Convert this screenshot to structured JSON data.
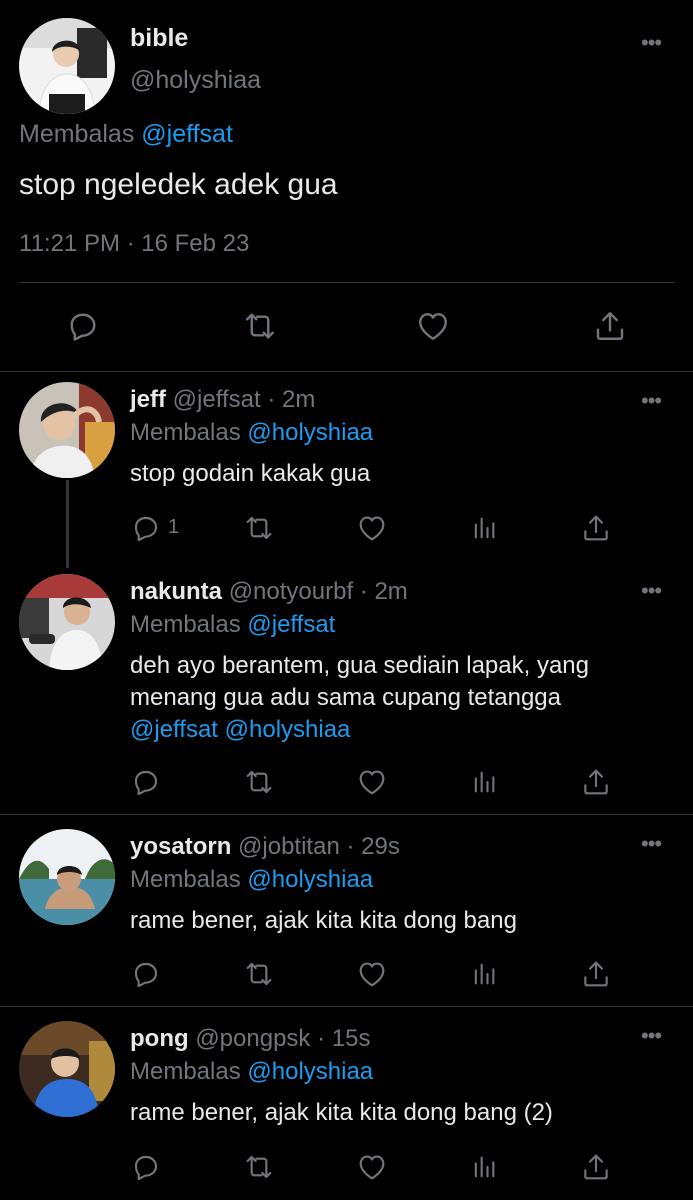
{
  "main_tweet": {
    "name": "bible",
    "handle": "@holyshiaa",
    "reply_prefix": "Membalas",
    "reply_to": "@jeffsat",
    "text": "stop ngeledek adek gua",
    "timestamp": "11:21 PM · 16 Feb 23"
  },
  "replies": [
    {
      "name": "jeff",
      "handle": "@jeffsat",
      "time": "· 2m",
      "reply_prefix": "Membalas",
      "reply_to": "@holyshiaa",
      "text": "stop godain kakak gua",
      "reply_count": "1"
    },
    {
      "name": "nakunta",
      "handle": "@notyourbf",
      "time": "· 2m",
      "reply_prefix": "Membalas",
      "reply_to": "@jeffsat",
      "text_line1": "deh ayo berantem, gua sediain lapak, yang",
      "text_line2": "menang gua adu sama cupang tetangga",
      "mention1": "@jeffsat",
      "mention2": "@holyshiaa"
    },
    {
      "name": "yosatorn",
      "handle": "@jobtitan",
      "time": "· 29s",
      "reply_prefix": "Membalas",
      "reply_to": "@holyshiaa",
      "text": "rame bener, ajak kita kita dong bang"
    },
    {
      "name": "pong",
      "handle": "@pongpsk",
      "time": "· 15s",
      "reply_prefix": "Membalas",
      "reply_to": "@holyshiaa",
      "text": "rame bener, ajak kita kita dong bang (2)"
    }
  ],
  "icons": {
    "reply": "reply-icon",
    "retweet": "retweet-icon",
    "like": "heart-icon",
    "views": "views-icon",
    "share": "share-icon",
    "more": "more-icon"
  },
  "colors": {
    "background": "#000000",
    "text": "#e7e9ea",
    "muted": "#71767b",
    "link": "#1d9bf0",
    "divider": "#2f3336"
  }
}
